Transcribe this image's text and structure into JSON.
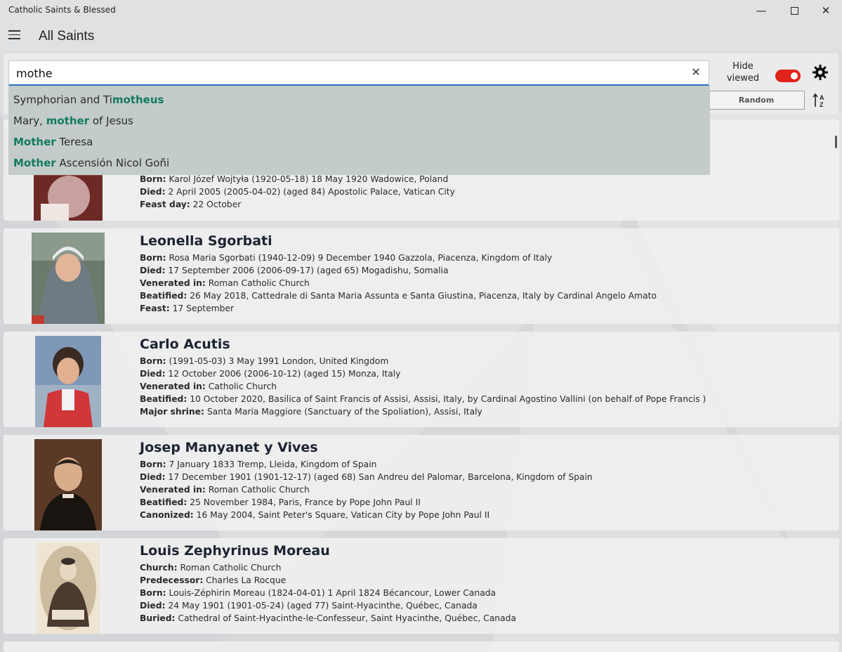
{
  "window": {
    "title": "Catholic Saints & Blessed",
    "minimize": "—",
    "close": "✕"
  },
  "header": {
    "page_title": "All Saints"
  },
  "toolbar": {
    "search_value": "mothe",
    "clear": "✕",
    "hide_viewed_line1": "Hide",
    "hide_viewed_line2": "viewed",
    "hide_viewed_on": true,
    "random_label": "Random",
    "toggle_color": "#e0241b"
  },
  "suggestions": [
    {
      "before": "Symphorian and Ti",
      "match": "motheus",
      "after": ""
    },
    {
      "before": "Mary, ",
      "match": "mother",
      "after": " of Jesus"
    },
    {
      "before": "",
      "match": "Mother",
      "after": " Teresa"
    },
    {
      "before": "",
      "match": "Mother",
      "after": " Ascensión Nicol Goñi"
    }
  ],
  "cards": [
    {
      "name": "",
      "fields": [
        {
          "label": "Born:",
          "value": "Karol Józef Wojtyła (1920-05-18) 18 May 1920 Wadowice, Poland"
        },
        {
          "label": "Died:",
          "value": "2 April 2005 (2005-04-02) (aged 84) Apostolic Palace, Vatican City"
        },
        {
          "label": "Feast day:",
          "value": "22 October"
        }
      ]
    },
    {
      "name": "Leonella Sgorbati",
      "fields": [
        {
          "label": "Born:",
          "value": "Rosa Maria Sgorbati (1940-12-09) 9 December 1940 Gazzola, Piacenza, Kingdom of Italy"
        },
        {
          "label": "Died:",
          "value": "17 September 2006 (2006-09-17) (aged 65) Mogadishu, Somalia"
        },
        {
          "label": "Venerated in:",
          "value": "Roman Catholic Church"
        },
        {
          "label": "Beatified:",
          "value": "26 May 2018, Cattedrale di Santa Maria Assunta e Santa Giustina, Piacenza, Italy by Cardinal Angelo Amato"
        },
        {
          "label": "Feast:",
          "value": "17 September"
        }
      ]
    },
    {
      "name": "Carlo Acutis",
      "fields": [
        {
          "label": "Born:",
          "value": "(1991-05-03) 3 May 1991 London, United Kingdom"
        },
        {
          "label": "Died:",
          "value": "12 October 2006 (2006-10-12) (aged 15) Monza, Italy"
        },
        {
          "label": "Venerated in:",
          "value": "Catholic Church"
        },
        {
          "label": "Beatified:",
          "value": "10 October 2020, Basilica of Saint Francis of Assisi, Assisi, Italy, by Cardinal Agostino Vallini (on behalf of Pope Francis )"
        },
        {
          "label": "Major shrine:",
          "value": "Santa Maria Maggiore (Sanctuary of the Spoliation), Assisi, Italy"
        }
      ]
    },
    {
      "name": "Josep Manyanet y Vives",
      "fields": [
        {
          "label": "Born:",
          "value": "7 January 1833 Tremp, Lleida, Kingdom of Spain"
        },
        {
          "label": "Died:",
          "value": "17 December 1901 (1901-12-17) (aged 68) San Andreu del Palomar, Barcelona, Kingdom of Spain"
        },
        {
          "label": "Venerated in:",
          "value": "Roman Catholic Church"
        },
        {
          "label": "Beatified:",
          "value": "25 November 1984, Paris, France by Pope John Paul II"
        },
        {
          "label": "Canonized:",
          "value": "16 May 2004, Saint Peter's Square, Vatican City by Pope John Paul II"
        }
      ]
    },
    {
      "name": "Louis Zephyrinus Moreau",
      "fields": [
        {
          "label": "Church:",
          "value": "Roman Catholic Church"
        },
        {
          "label": "Predecessor:",
          "value": "Charles La Rocque"
        },
        {
          "label": "Born:",
          "value": "Louis-Zéphirin Moreau (1824-04-01) 1 April 1824 Bécancour, Lower Canada"
        },
        {
          "label": "Died:",
          "value": "24 May 1901 (1901-05-24) (aged 77) Saint-Hyacinthe, Québec, Canada"
        },
        {
          "label": "Buried:",
          "value": "Cathedral of Saint-Hyacinthe-le-Confesseur, Saint Hyacinthe, Québec, Canada"
        }
      ]
    }
  ]
}
